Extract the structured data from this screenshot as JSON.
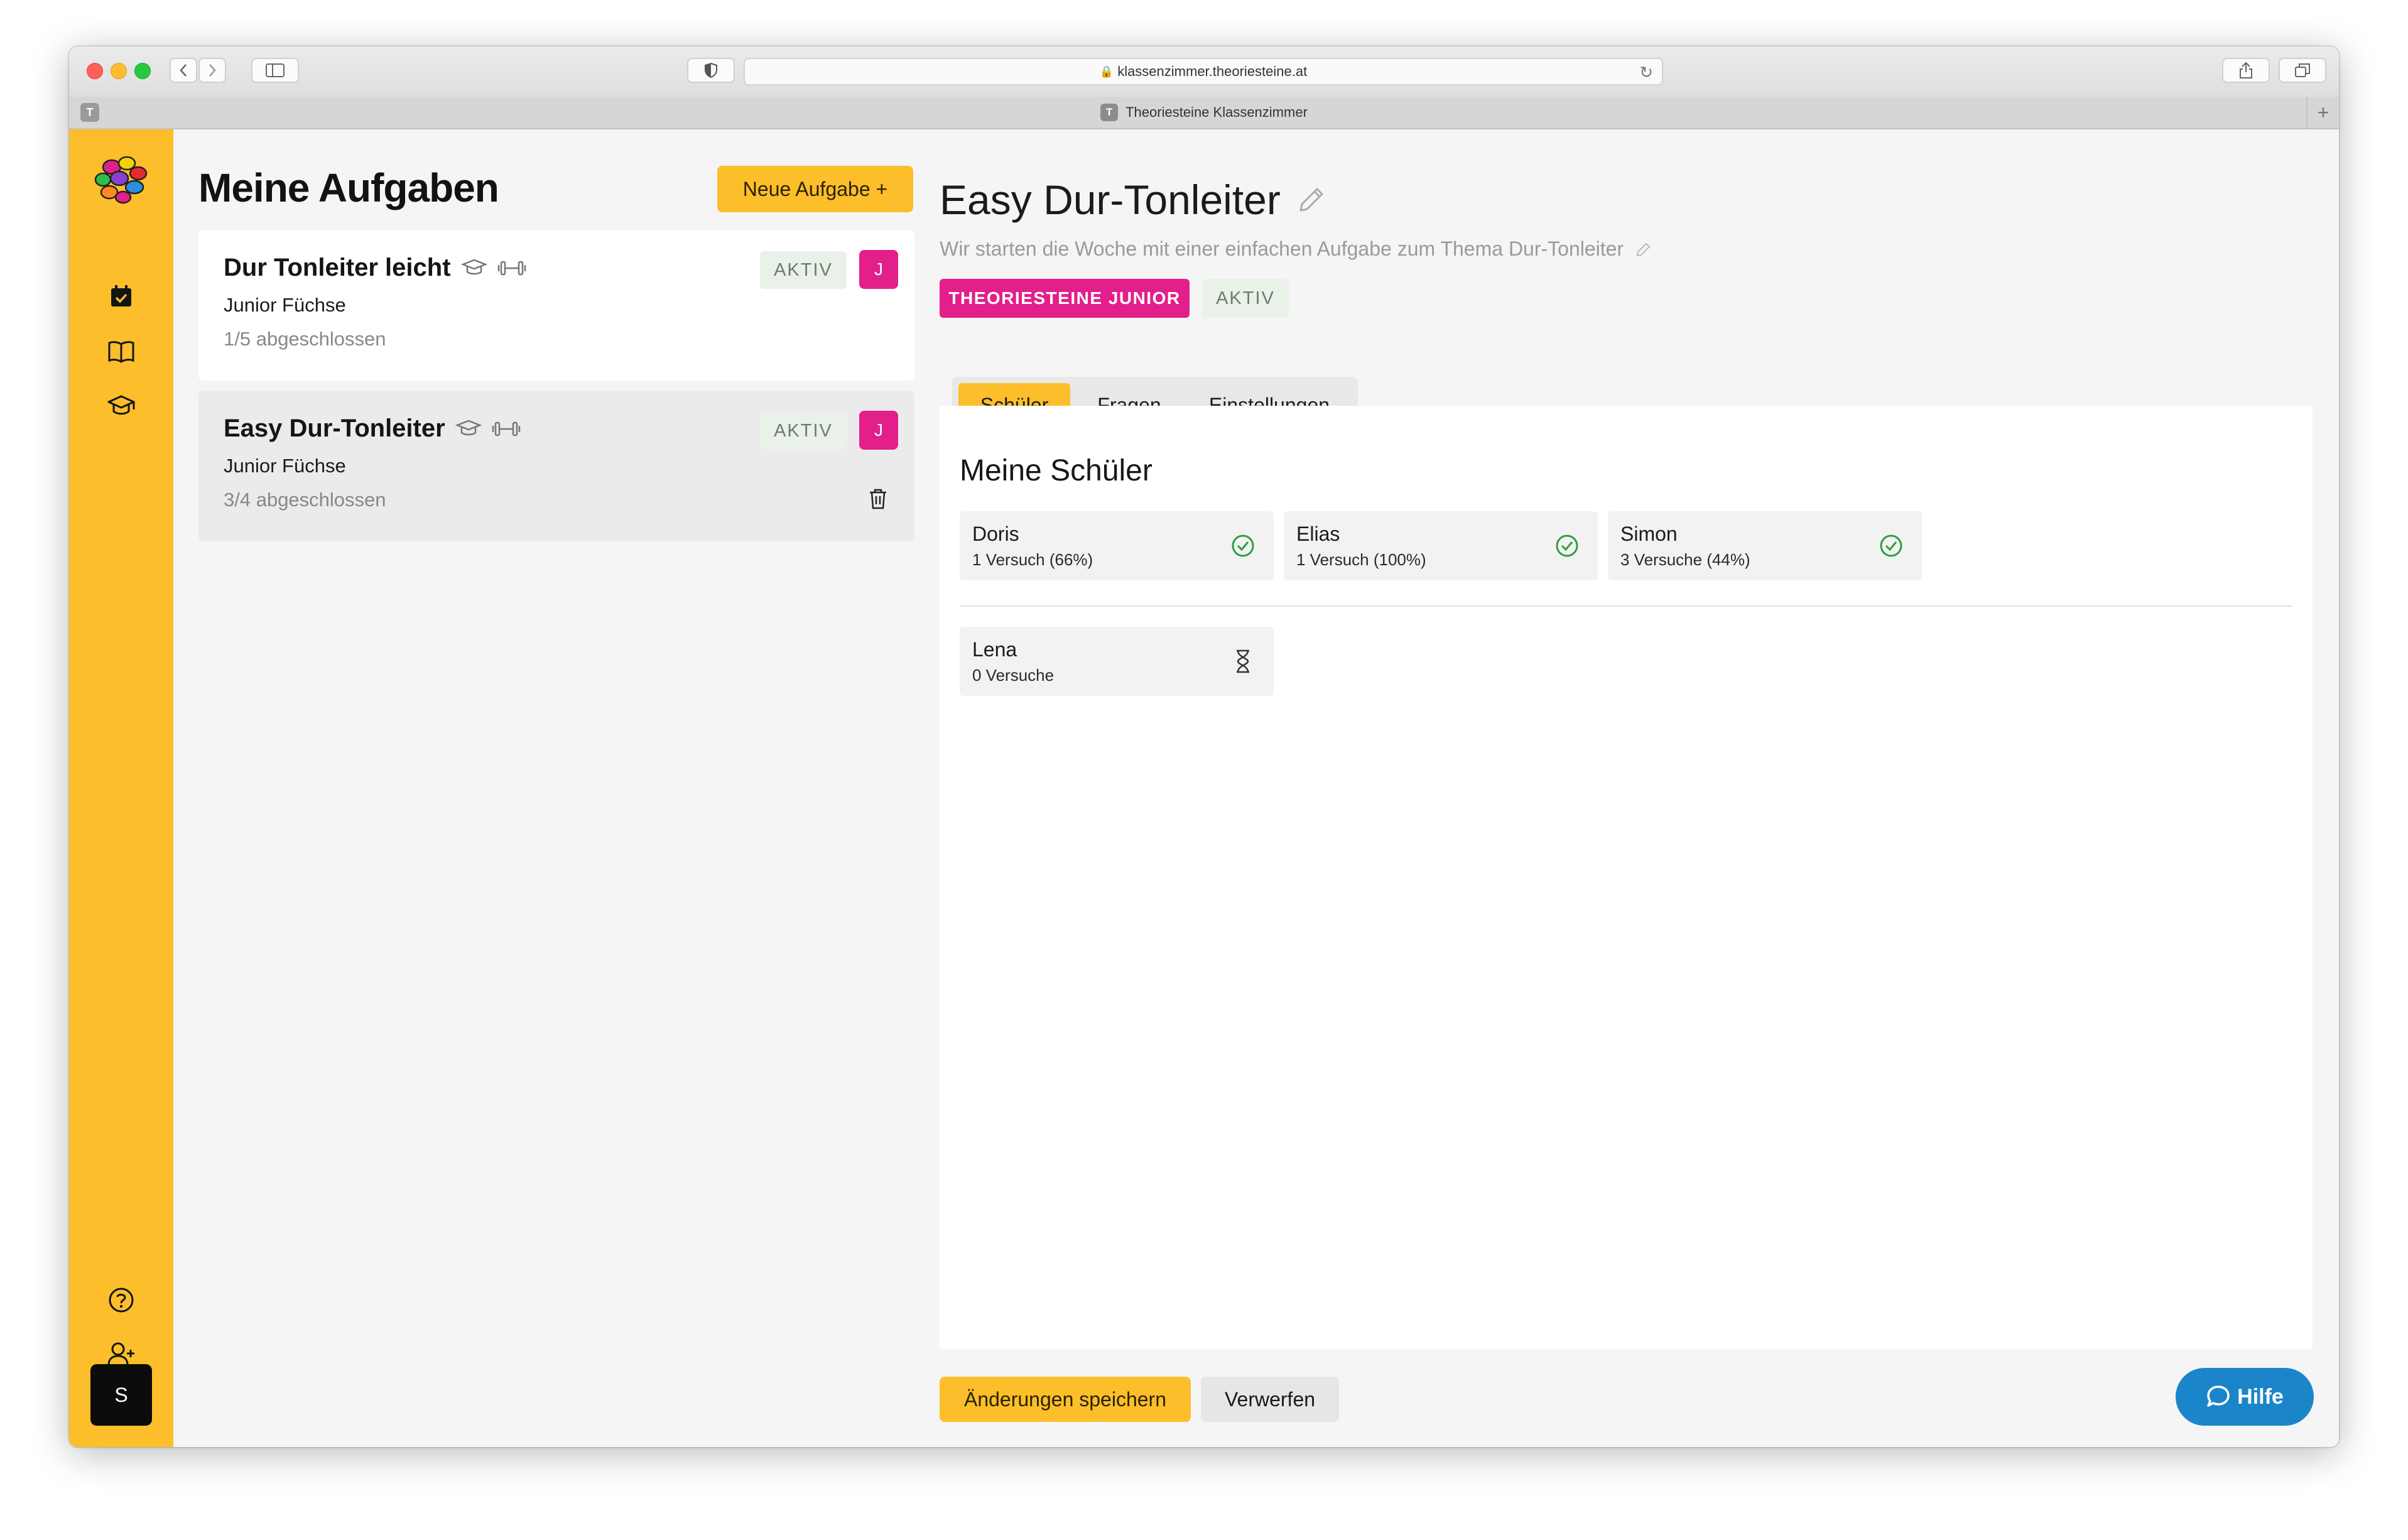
{
  "browser": {
    "url": "klassenzimmer.theoriesteine.at",
    "tab_title": "Theoriesteine Klassenzimmer",
    "tab_favicon_letter": "T"
  },
  "sidebar": {
    "icons": [
      "logo-icon",
      "calendar-check-icon",
      "book-open-icon",
      "graduation-cap-icon",
      "help-circle-icon",
      "user-plus-icon"
    ],
    "avatar_letter": "S"
  },
  "tasks": {
    "title": "Meine Aufgaben",
    "new_button": "Neue Aufgabe +",
    "items": [
      {
        "name": "Dur Tonleiter leicht",
        "class_name": "Junior Füchse",
        "progress": "1/5 abgeschlossen",
        "status": "AKTIV",
        "badge": "J"
      },
      {
        "name": "Easy Dur-Tonleiter",
        "class_name": "Junior Füchse",
        "progress": "3/4 abgeschlossen",
        "status": "AKTIV",
        "badge": "J"
      }
    ]
  },
  "detail": {
    "title": "Easy Dur-Tonleiter",
    "description": "Wir starten die Woche mit einer einfachen Aufgabe zum Thema Dur-Tonleiter",
    "course_tag": "THEORIESTEINE JUNIOR",
    "status": "AKTIV",
    "tabs": [
      "Schüler",
      "Fragen",
      "Einstellungen"
    ],
    "active_tab": "Schüler",
    "panel_title": "Meine Schüler",
    "completed_students": [
      {
        "name": "Doris",
        "attempts": "1 Versuch (66%)"
      },
      {
        "name": "Elias",
        "attempts": "1 Versuch (100%)"
      },
      {
        "name": "Simon",
        "attempts": "3 Versuche (44%)"
      }
    ],
    "pending_students": [
      {
        "name": "Lena",
        "attempts": "0 Versuche"
      }
    ]
  },
  "actions": {
    "save": "Änderungen speichern",
    "discard": "Verwerfen",
    "help": "Hilfe"
  },
  "colors": {
    "accent": "#fcbe2a",
    "magenta": "#e21f8a",
    "help_blue": "#1a86c9",
    "success": "#2e9e3e"
  }
}
